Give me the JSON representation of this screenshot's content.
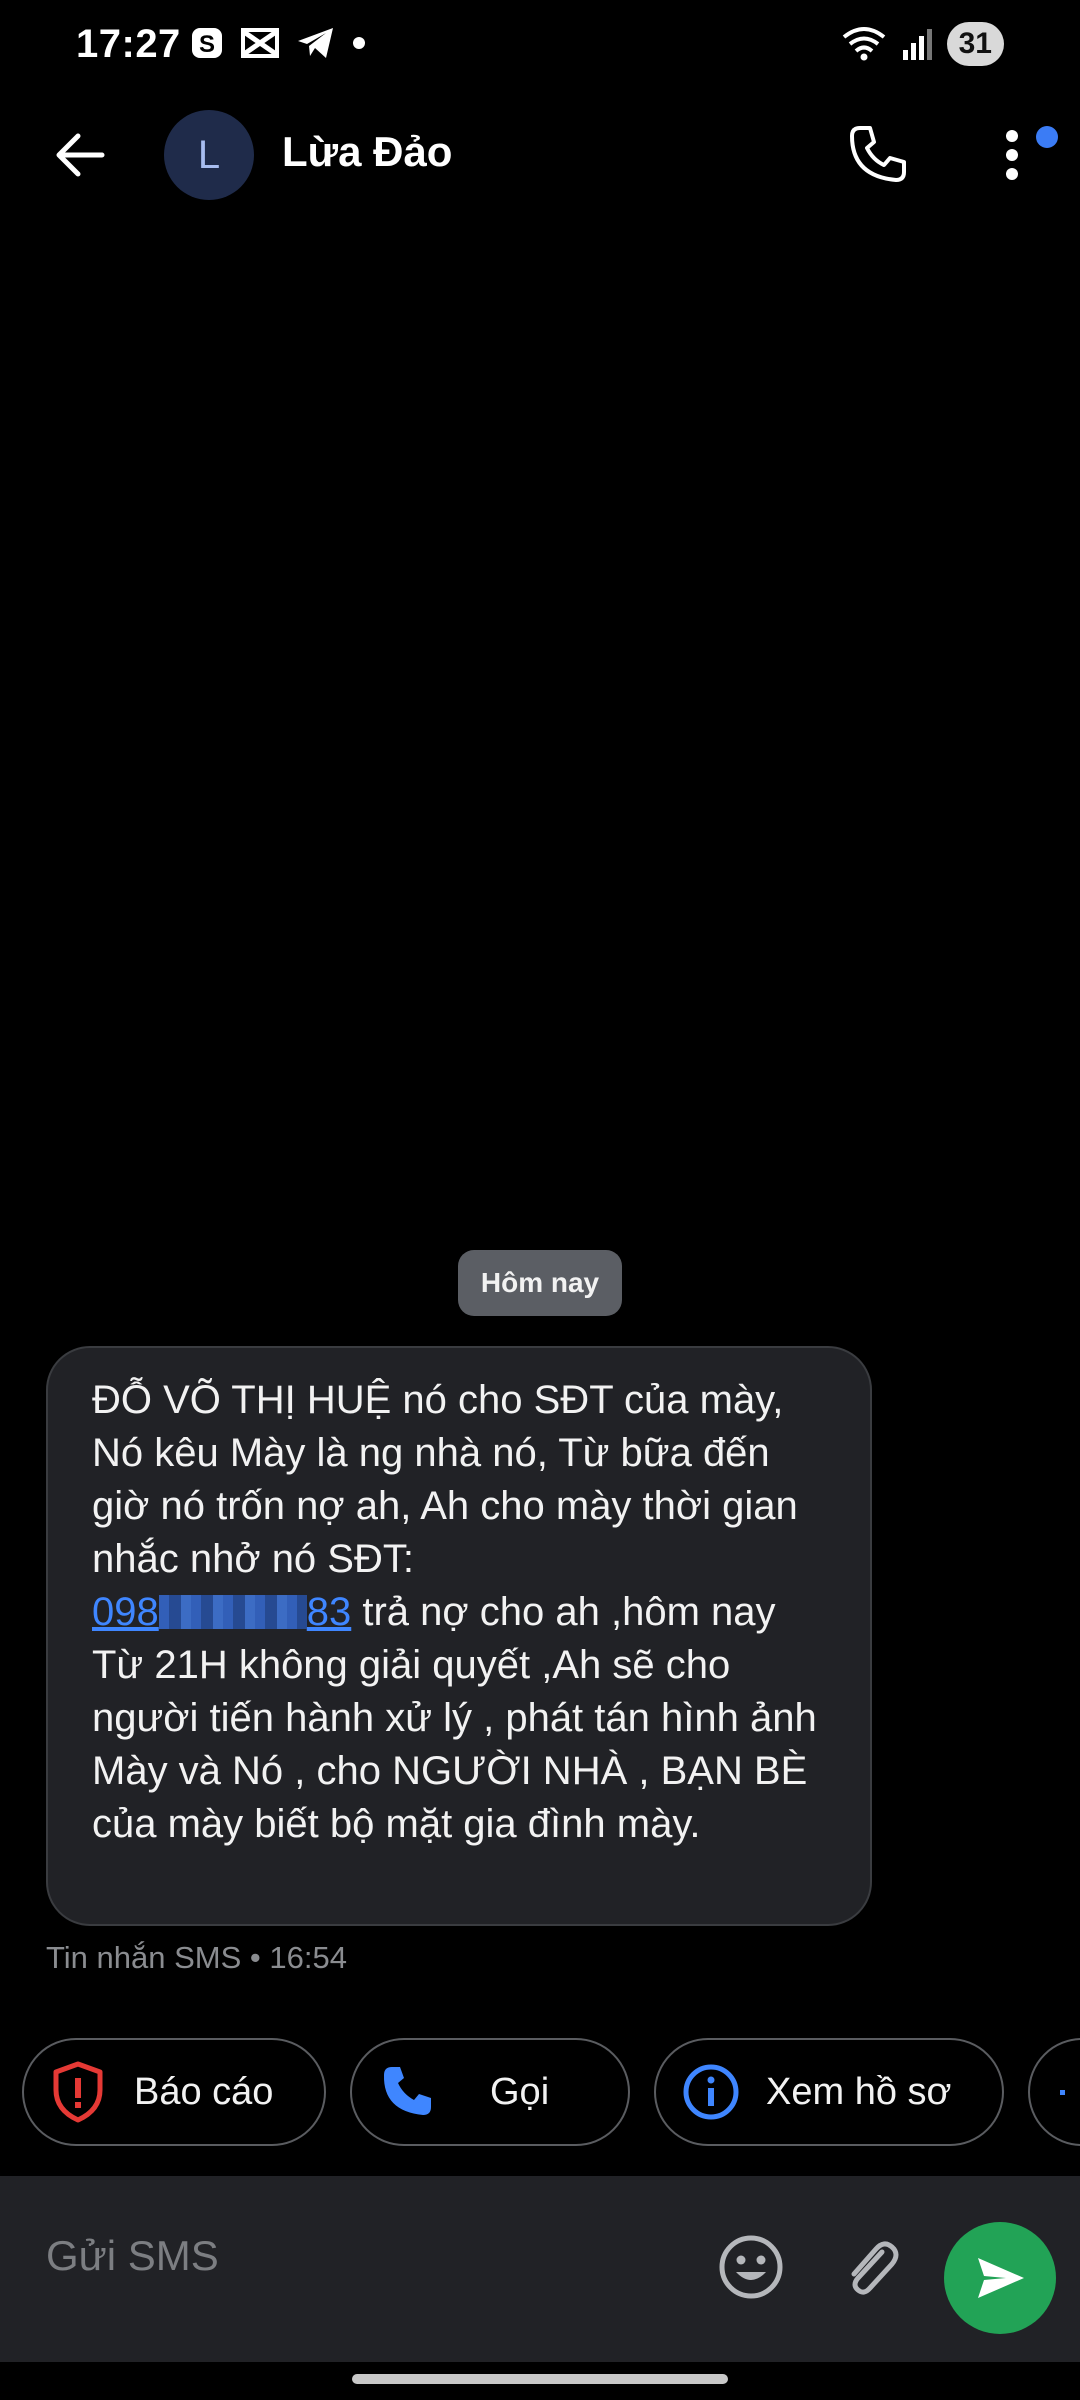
{
  "status_bar": {
    "time": "17:27",
    "battery": "31"
  },
  "header": {
    "avatar_letter": "L",
    "contact_name": "Lừa Đảo"
  },
  "conversation": {
    "date_chip": "Hôm nay",
    "message": {
      "text_before": "ĐỖ VÕ THỊ HUỆ nó cho SĐT của mày, Nó kêu Mày là ng nhà nó, Từ bữa đến giờ nó trốn nợ ah, Ah cho mày thời gian nhắc nhở nó SĐT:",
      "phone_prefix": "098",
      "phone_suffix": "83",
      "text_after": " trả nợ cho ah ,hôm nay Từ 21H không giải quyết ,Ah sẽ cho người tiến hành xử lý , phát tán hình ảnh Mày và Nó , cho NGƯỜI NHÀ , BẠN BÈ của mày biết bộ mặt gia đình mày.",
      "meta": "Tin nhắn SMS • 16:54"
    }
  },
  "actions": {
    "report": "Báo cáo",
    "call": "Gọi",
    "profile": "Xem hồ sơ"
  },
  "compose": {
    "placeholder": "Gửi SMS"
  },
  "colors": {
    "accent": "#3f86ff",
    "send": "#22a356",
    "danger": "#e53935"
  }
}
